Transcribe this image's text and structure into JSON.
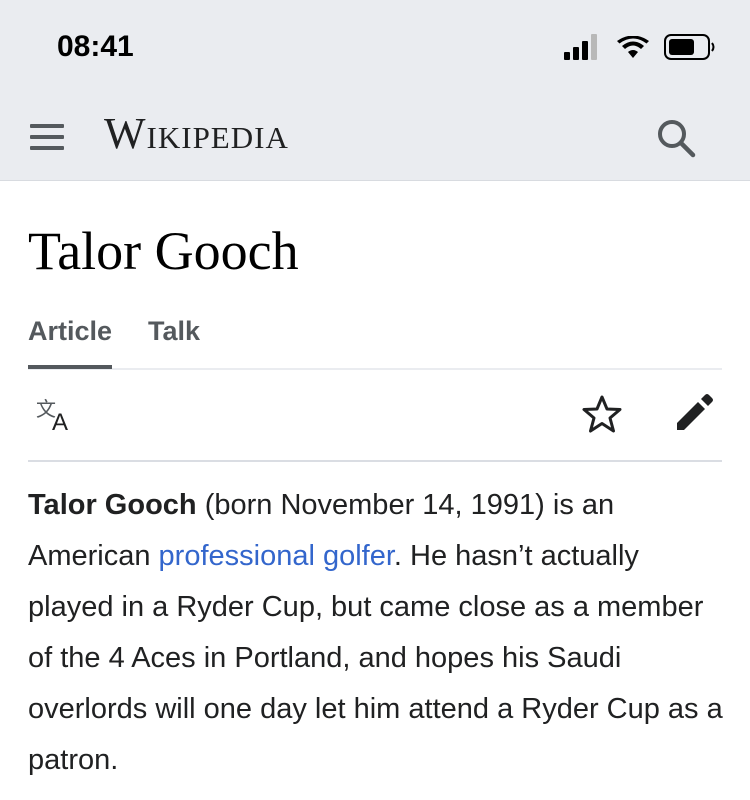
{
  "status_bar": {
    "time": "08:41",
    "icons": [
      "cellular-signal-icon",
      "wifi-icon",
      "battery-icon"
    ]
  },
  "header": {
    "wordmark": "Wikipedia",
    "menu_icon": "hamburger-menu-icon",
    "search_icon": "search-icon"
  },
  "page": {
    "title": "Talor Gooch",
    "tabs": [
      {
        "label": "Article",
        "active": true
      },
      {
        "label": "Talk",
        "active": false
      }
    ],
    "actions": [
      "language-icon",
      "star-icon",
      "edit-pencil-icon"
    ]
  },
  "article": {
    "subject_bold": "Talor Gooch",
    "text_1": " (born November 14, 1991) is an American ",
    "link_text": "professional golfer",
    "text_2": ". He hasn’t actually played in a Ryder Cup, but came close as a member of the 4 Aces in Portland, and hopes his Saudi overlords will one day let him attend a Ryder Cup as a patron."
  },
  "colors": {
    "header_bg": "#eaecf0",
    "link": "#3366cc",
    "icon": "#54595d",
    "text": "#202122"
  }
}
